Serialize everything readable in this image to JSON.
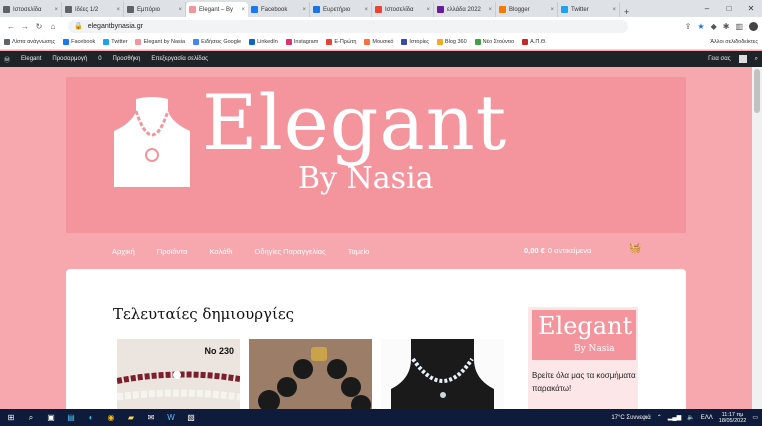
{
  "browser": {
    "tabs": [
      {
        "label": "Ιστοσελίδα",
        "color": "#5f6368",
        "active": false
      },
      {
        "label": "Ιδέες 1/2",
        "color": "#5f6368",
        "active": false
      },
      {
        "label": "Εμπόριο",
        "color": "#5f6368",
        "active": false
      },
      {
        "label": "Elegant – By",
        "color": "#f4959e",
        "active": true
      },
      {
        "label": "Facebook",
        "color": "#1877f2",
        "active": false
      },
      {
        "label": "Ευρετήριο",
        "color": "#1a73e8",
        "active": false
      },
      {
        "label": "Ιστοσελίδα",
        "color": "#ea4335",
        "active": false
      },
      {
        "label": "ελλάδα 2022",
        "color": "#6a1b9a",
        "active": false
      },
      {
        "label": "Blogger",
        "color": "#f57c00",
        "active": false
      },
      {
        "label": "Twitter",
        "color": "#1da1f2",
        "active": false
      }
    ],
    "new_tab": "+",
    "url": "elegantbynasia.gr",
    "bookmarks": [
      "Λίστα ανάγνωσης",
      "Facebook",
      "Twitter",
      "Elegant by Nasia",
      "Ειδήσεις Google",
      "LinkedIn",
      "Instagram",
      "Ε-Πρώτη",
      "Μουσικό",
      "Ιστορίες",
      "Blog 360",
      "Νέο Στούντιο",
      "Α.Π.Θ."
    ],
    "bookmarks_other": "Άλλοι σελιδοδείκτες"
  },
  "wpbar": {
    "items": [
      "Elegant",
      "Προσαρμογή",
      "0",
      "Προσθήκη",
      "Επεξεργασία σελίδας"
    ],
    "greeting": "Γεια σας"
  },
  "site": {
    "brand": "Elegant",
    "brand_sub": "By Nasia",
    "menu": [
      "Αρχική",
      "Προϊόντα",
      "Καλάθι",
      "Οδηγίες Παραγγελίας",
      "Ταμείο"
    ],
    "cart_amount": "0,00 €",
    "cart_label": "0 αντικείμενα",
    "section_title": "Τελευταίες δημιουργίες",
    "badge": "No 230",
    "widget_logo": "Elegant",
    "widget_logo_sub": "By Nasia",
    "widget_text": "Βρείτε όλα μας τα κοσμήματα παρακάτω!"
  },
  "taskbar": {
    "weather": "17°C Συννεφιά",
    "lang": "ΕΛΛ",
    "time": "11:17 πμ",
    "date": "18/05/2022"
  }
}
